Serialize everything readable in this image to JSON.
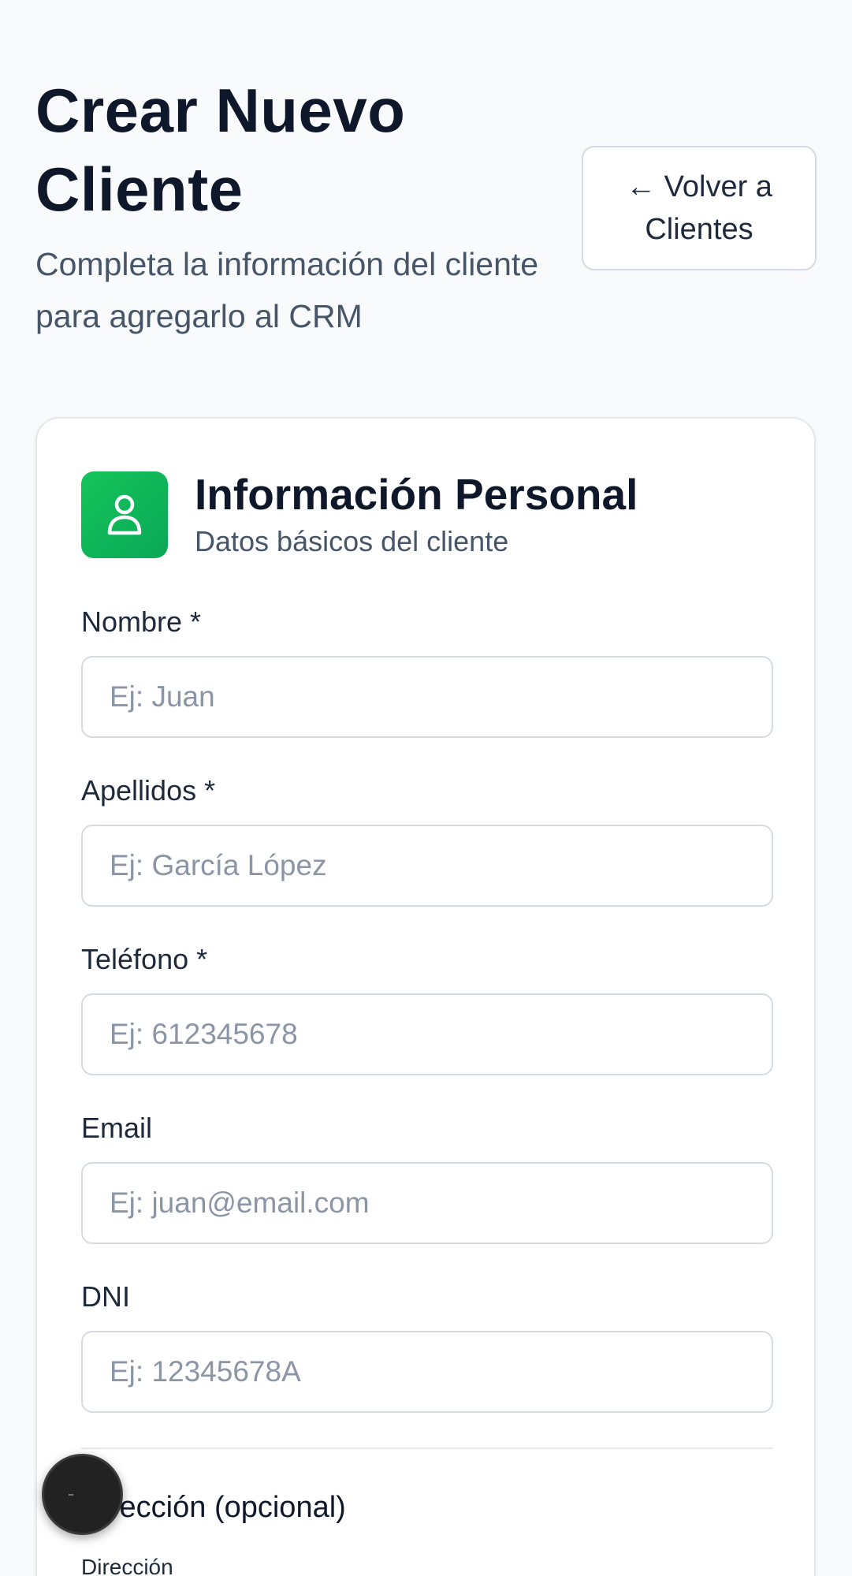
{
  "header": {
    "title": "Crear Nuevo Cliente",
    "subtitle": "Completa la información del cliente para agregarlo al CRM",
    "back_button_label": "← Volver a Clientes"
  },
  "section": {
    "icon": "user-icon",
    "title": "Información Personal",
    "subtitle": "Datos básicos del cliente"
  },
  "fields": {
    "nombre": {
      "label": "Nombre *",
      "placeholder": "Ej: Juan",
      "value": ""
    },
    "apellidos": {
      "label": "Apellidos *",
      "placeholder": "Ej: García López",
      "value": ""
    },
    "telefono": {
      "label": "Teléfono *",
      "placeholder": "Ej: 612345678",
      "value": ""
    },
    "email": {
      "label": "Email",
      "placeholder": "Ej: juan@email.com",
      "value": ""
    },
    "dni": {
      "label": "DNI",
      "placeholder": "Ej: 12345678A",
      "value": ""
    }
  },
  "address": {
    "title": "Dirección (opcional)",
    "field_label": "Dirección"
  },
  "colors": {
    "accent": "#0fbf5a",
    "background": "#f8fafc",
    "text": "#0f172a",
    "muted": "#475569"
  }
}
